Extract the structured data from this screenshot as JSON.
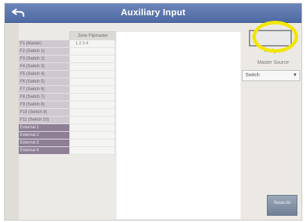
{
  "window": {
    "title": "Auxiliary Input"
  },
  "grid": {
    "column_header": "Zone Flipmaster",
    "rows": [
      {
        "label": "F1 (Master)",
        "value": "1  2  3  4"
      },
      {
        "label": "F2 (Switch 1)",
        "value": ""
      },
      {
        "label": "F3 (Switch 2)",
        "value": ""
      },
      {
        "label": "F4 (Switch 3)",
        "value": ""
      },
      {
        "label": "F5 (Switch 4)",
        "value": ""
      },
      {
        "label": "F6 (Switch 5)",
        "value": ""
      },
      {
        "label": "F7 (Switch 6)",
        "value": ""
      },
      {
        "label": "F8 (Switch 7)",
        "value": ""
      },
      {
        "label": "F9 (Switch 8)",
        "value": ""
      },
      {
        "label": "F10 (Switch 9)",
        "value": ""
      },
      {
        "label": "F11 (Switch 10)",
        "value": ""
      },
      {
        "label": "External 1",
        "value": ""
      },
      {
        "label": "External 2",
        "value": ""
      },
      {
        "label": "External 3",
        "value": ""
      },
      {
        "label": "External 4",
        "value": ""
      }
    ]
  },
  "right_panel": {
    "assign_label": "Assign",
    "master_source_label": "Master Source",
    "master_source_value": "Switch",
    "reset_label": "Reset All"
  },
  "colors": {
    "title_bar": "#5a74ac",
    "highlight": "#f2e600",
    "external_rows": "#8e7f95"
  },
  "icons": {
    "back": "back-arrow-icon",
    "dropdown": "caret-down-icon"
  }
}
